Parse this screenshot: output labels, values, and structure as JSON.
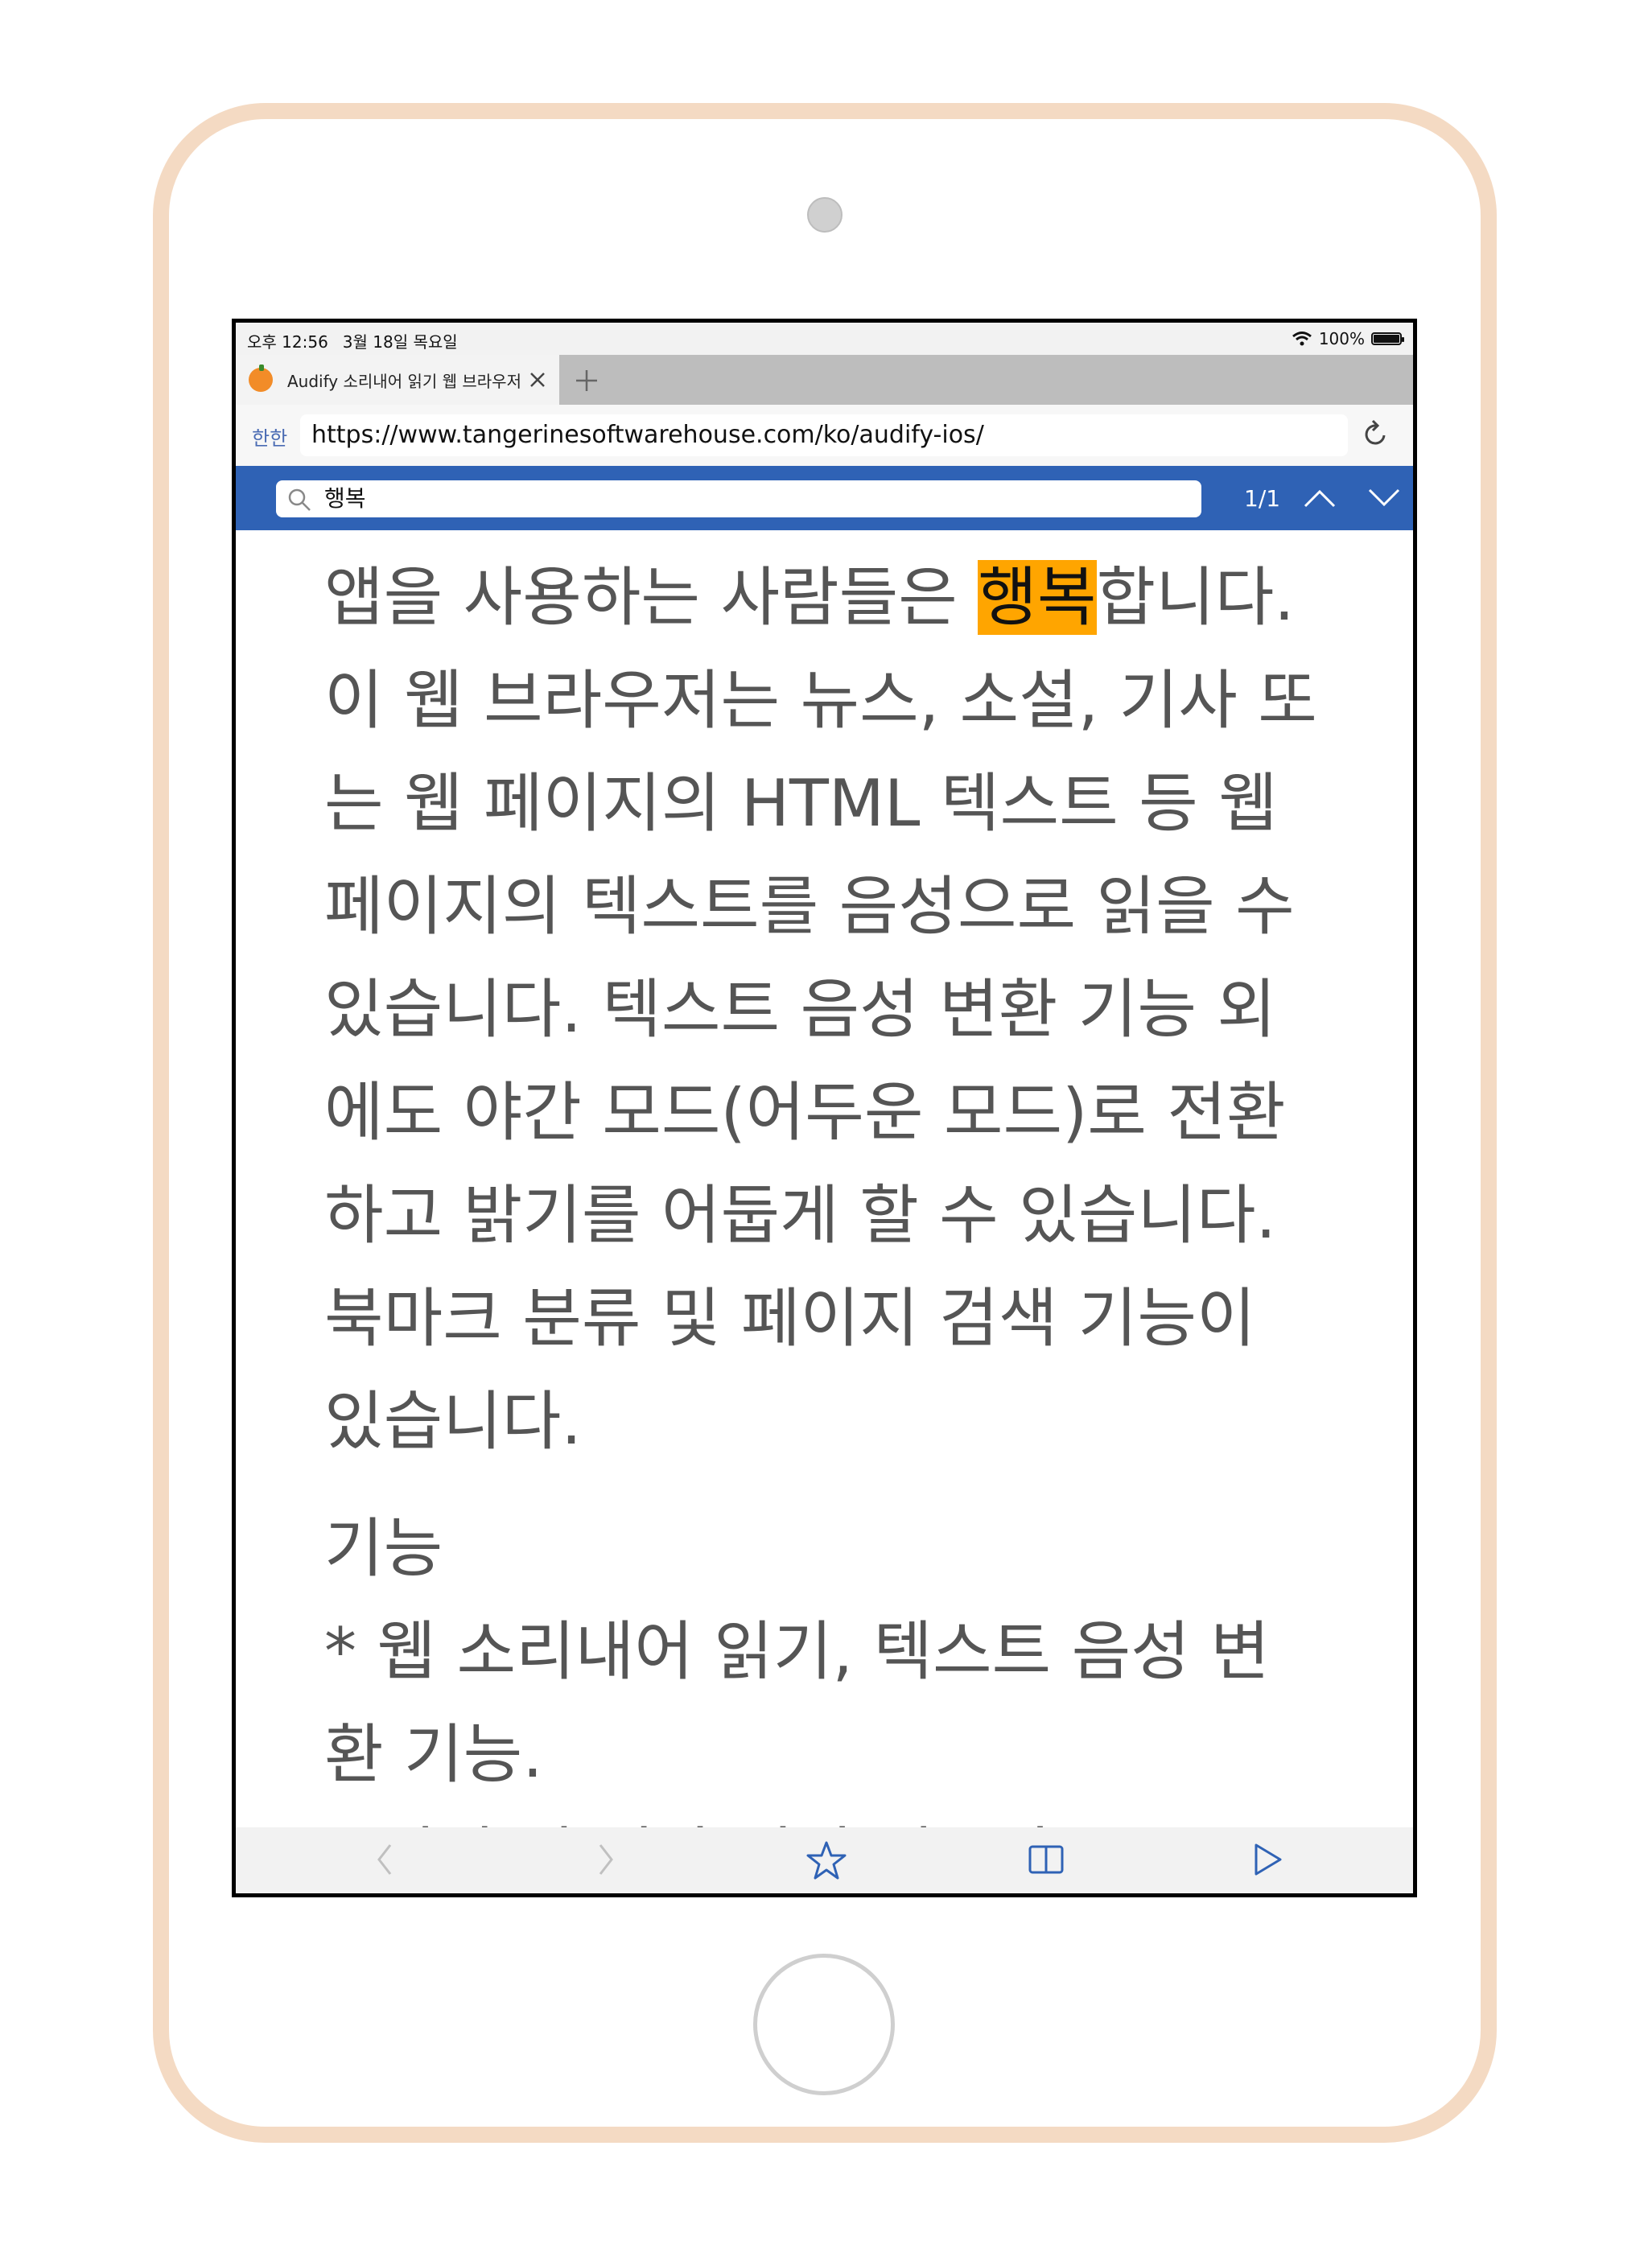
{
  "status": {
    "time": "오후 12:56",
    "date": "3월 18일 목요일",
    "battery": "100%"
  },
  "tab": {
    "title": "Audify 소리내어 읽기 웹 브라우저",
    "favicon": "tangerine-icon"
  },
  "url_bar": {
    "translate_label": "한한",
    "url": "https://www.tangerinesoftwarehouse.com/ko/audify-ios/"
  },
  "find": {
    "query": "행복",
    "count": "1/1"
  },
  "content": {
    "para_before": "앱을 사용하는 사람들은 ",
    "highlight": "행복",
    "para_after": "합니다. 이 웹 브라우저는 뉴스, 소설, 기사 또는 웹 페이지의 HTML 텍스트 등 웹 페이지의 텍스트를 음성으로 읽을 수 있습니다. 텍스트 음성 변환 기능 외에도 야간 모드(어두운 모드)로 전환하고 밝기를 어둡게 할 수 있습니다. 북마크 분류 및 페이지 검색 기능이 있습니다.",
    "heading": "기능",
    "list": [
      "* 웹 소리내어 읽기, 텍스트 음성 변환 기능.",
      "* 영어 및 기타 언어 배우기"
    ]
  },
  "colors": {
    "frame": "#f4dac3",
    "find_bar": "#2f62b5",
    "highlight": "#ffa500",
    "text": "#555555"
  },
  "icons": {
    "back": "chevron-left-icon",
    "forward": "chevron-right-icon",
    "bookmark": "star-icon",
    "tabs": "book-open-icon",
    "play": "play-icon"
  }
}
